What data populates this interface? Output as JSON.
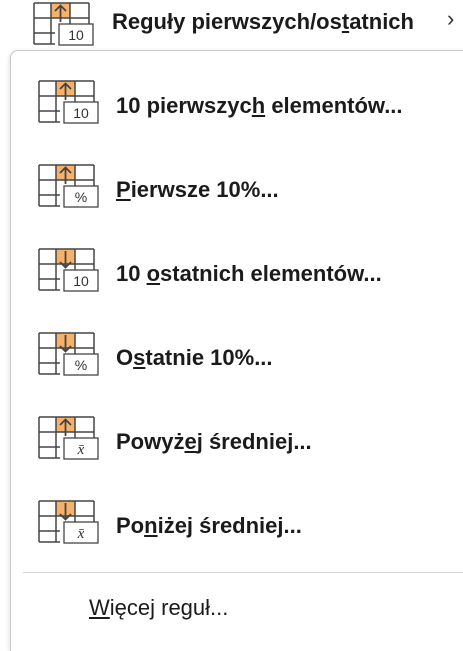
{
  "colors": {
    "accent_orange": "#f6b26b",
    "icon_stroke": "#454545",
    "text": "#1b1b1b",
    "separator": "#d6d6d6"
  },
  "parent": {
    "label_before": "Reguły pierwszych/os",
    "label_underlined": "t",
    "label_after": "atnich",
    "icon": "top-10-rules-icon",
    "icon_badge": "10",
    "chevron": "›"
  },
  "items": [
    {
      "label_before": "10 pierwszyc",
      "label_underlined": "h",
      "label_after": " elementów...",
      "icon": "top-10-items-icon",
      "icon_badge": "10",
      "direction": "up"
    },
    {
      "label_before": "",
      "label_underlined": "P",
      "label_after": "ierwsze 10%...",
      "icon": "top-10-percent-icon",
      "icon_badge": "%",
      "direction": "up"
    },
    {
      "label_before": "10 ",
      "label_underlined": "o",
      "label_after": "statnich elementów...",
      "icon": "bottom-10-items-icon",
      "icon_badge": "10",
      "direction": "down"
    },
    {
      "label_before": "O",
      "label_underlined": "s",
      "label_after": "tatnie 10%...",
      "icon": "bottom-10-percent-icon",
      "icon_badge": "%",
      "direction": "down"
    },
    {
      "label_before": "Powyż",
      "label_underlined": "e",
      "label_after": "j średniej...",
      "icon": "above-average-icon",
      "icon_badge": "x̄",
      "direction": "up"
    },
    {
      "label_before": "Po",
      "label_underlined": "n",
      "label_after": "iżej średniej...",
      "icon": "below-average-icon",
      "icon_badge": "x̄",
      "direction": "down"
    }
  ],
  "more": {
    "label_underlined": "W",
    "label_after": "ięcej reguł..."
  }
}
